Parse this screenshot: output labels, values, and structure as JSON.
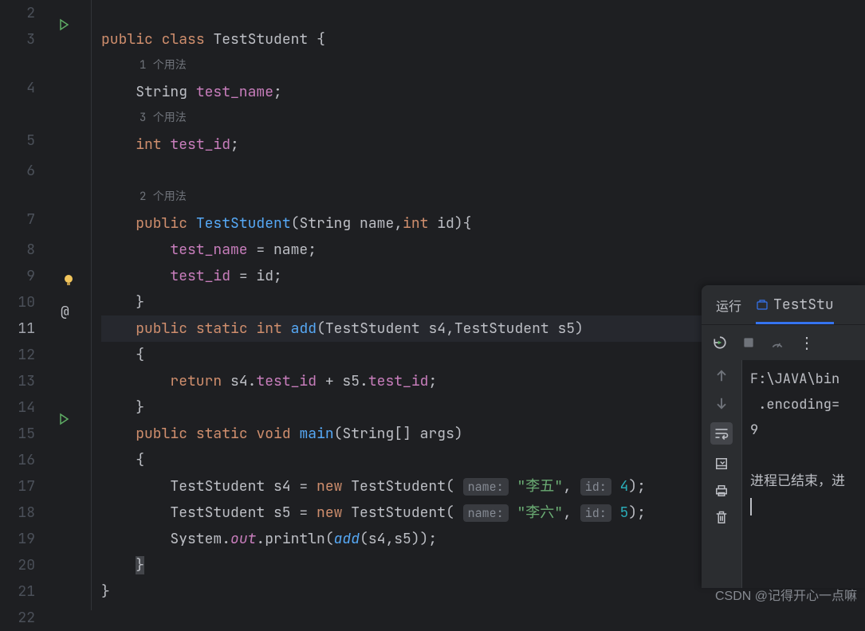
{
  "gutter": {
    "lines": [
      "2",
      "3",
      "4",
      "5",
      "6",
      "7",
      "8",
      "9",
      "10",
      "11",
      "12",
      "13",
      "14",
      "15",
      "16",
      "17",
      "18",
      "19",
      "20",
      "21",
      "22"
    ],
    "active_line": "11"
  },
  "usages": {
    "u1": "1 个用法",
    "u3": "3 个用法",
    "u2": "2 个用法"
  },
  "code": {
    "l3_public": "public",
    "l3_class": "class",
    "l3_name": "TestStudent",
    "l3_brace": "{",
    "l4_type": "String ",
    "l4_field": "test_name",
    "l4_semi": ";",
    "l5_kw": "int",
    "l5_field": "test_id",
    "l5_semi": ";",
    "l7_public": "public",
    "l7_ctor": "TestStudent",
    "l7_sig1": "(String name,",
    "l7_intkw": "int",
    "l7_sig2": " id){",
    "l8_field": "test_name",
    "l8_rest": " = name;",
    "l9_field": "test_id",
    "l9_rest": " = id;",
    "l10": "}",
    "l11_public": "public",
    "l11_static": "static",
    "l11_int": "int",
    "l11_method": "add",
    "l11_params": "(TestStudent s4,TestStudent s5)",
    "l12": "{",
    "l13_kw": "return",
    "l13_s4": " s4.",
    "l13_f1": "test_id",
    "l13_plus": " + s5.",
    "l13_f2": "test_id",
    "l13_semi": ";",
    "l14": "}",
    "l15_public": "public",
    "l15_static": "static",
    "l15_void": "void",
    "l15_main": "main",
    "l15_params": "(String[] args)",
    "l16": "{",
    "l17_a": "TestStudent s4 = ",
    "l17_new": "new",
    "l17_b": " TestStudent(",
    "l17_hint1": "name:",
    "l17_str": "\"李五\"",
    "l17_c": ", ",
    "l17_hint2": "id:",
    "l17_num": "4",
    "l17_d": ");",
    "l18_a": "TestStudent s5 = ",
    "l18_new": "new",
    "l18_b": " TestStudent(",
    "l18_hint1": "name:",
    "l18_str": "\"李六\"",
    "l18_c": ", ",
    "l18_hint2": "id:",
    "l18_num": "5",
    "l18_d": ");",
    "l19_a": "System.",
    "l19_out": "out",
    "l19_b": ".println(",
    "l19_add": "add",
    "l19_c": "(s4,s5));",
    "l20": "}",
    "l21": "}"
  },
  "run_panel": {
    "tab_label": "运行",
    "tab_active": "TestStu",
    "output_line1": "F:\\JAVA\\bin",
    "output_line2": ".encoding=",
    "output_line3": "9",
    "output_line4": "",
    "output_line5": "进程已结束，进"
  },
  "watermark": "CSDN @记得开心一点嘛"
}
